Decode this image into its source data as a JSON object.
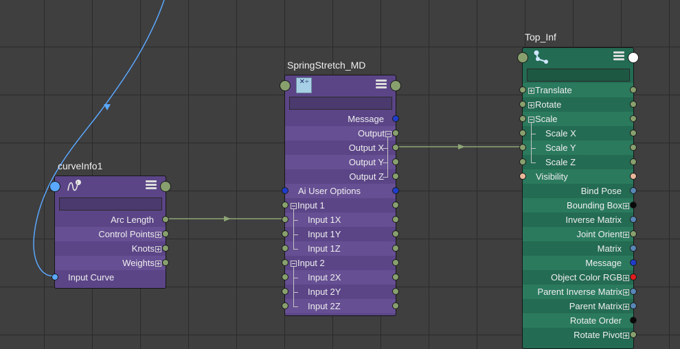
{
  "nodes": {
    "curve_info": {
      "title": "curveInfo1",
      "attributes": [
        "Arc Length",
        "Control Points",
        "Knots",
        "Weights",
        "Input Curve"
      ]
    },
    "spring_stretch": {
      "title": "SpringStretch_MD",
      "icon_glyph": "✕÷",
      "attributes": [
        "Message",
        "Output",
        "Output X",
        "Output Y",
        "Output Z",
        "Ai User Options",
        "Input 1",
        "Input 1X",
        "Input 1Y",
        "Input 1Z",
        "Input 2",
        "Input 2X",
        "Input 2Y",
        "Input 2Z"
      ]
    },
    "top_inf": {
      "title": "Top_Inf",
      "attributes": [
        "Translate",
        "Rotate",
        "Scale",
        "Scale X",
        "Scale Y",
        "Scale Z",
        "Visibility",
        "Bind Pose",
        "Bounding Box",
        "Inverse Matrix",
        "Joint Orient",
        "Matrix",
        "Message",
        "Object Color RGB",
        "Parent Inverse Matrix",
        "Parent Matrix",
        "Rotate Order",
        "Rotate Pivot"
      ]
    }
  },
  "colors": {
    "graph_background": "#3f3f3f",
    "utility_node": "#5b4587",
    "joint_node": "#236b52",
    "selected_wire": "#5aa8ff",
    "connection_wire": "#8fa675"
  },
  "icons": [
    "curve-info-icon",
    "multiply-divide-icon",
    "joint-icon",
    "node-menu-icon"
  ]
}
